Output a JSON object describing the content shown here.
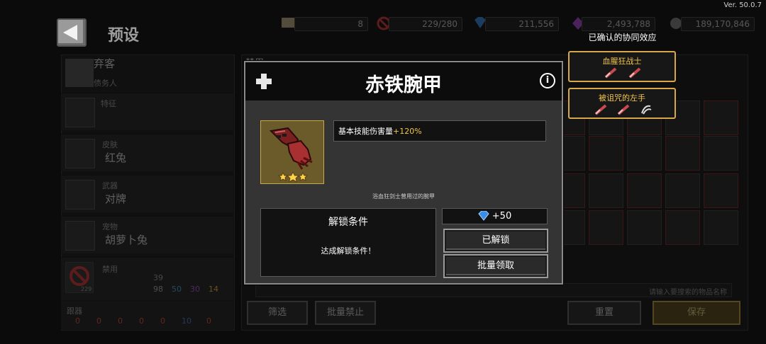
{
  "header": {
    "title": "预设",
    "version": "Ver. 50.0.7",
    "resources": [
      {
        "icon": "scroll-icon",
        "value": "8"
      },
      {
        "icon": "ban-icon",
        "value": "229/280"
      },
      {
        "icon": "diamond-icon",
        "value": "211,556"
      },
      {
        "icon": "purple-gem-icon",
        "value": "2,493,788"
      },
      {
        "icon": "coin-icon",
        "value": "189,170,846"
      }
    ]
  },
  "left_panel": {
    "character_name": "弃客",
    "character_sub": "债务人",
    "trait_label": "特征",
    "skin_label": "皮肤",
    "skin_value": "红兔",
    "weapon_label": "武器",
    "weapon_value": "对牌",
    "pet_label": "宠物",
    "pet_value": "胡萝卜兔",
    "ban_label": "禁用",
    "ban_count": "229",
    "ban_total": "39",
    "ban_breakdown": [
      "98",
      "50",
      "30",
      "14"
    ],
    "bottom_label": "跟器",
    "bottom_values": [
      "0",
      "0",
      "0",
      "0",
      "0",
      "10",
      "0"
    ]
  },
  "grid_panel": {
    "header_label": "禁用",
    "search_placeholder": "请输入要搜索的物品名称",
    "filter_button": "筛选",
    "batch_ban_button": "批量禁止",
    "reset_button": "重置",
    "save_button": "保存"
  },
  "modal": {
    "title": "赤铁腕甲",
    "stat_text": "基本技能伤害量",
    "stat_value": "+120%",
    "description": "浴血狂剑士曾用过的腕甲",
    "unlock_title": "解锁条件",
    "unlock_text": "达成解锁条件！",
    "cost": "+50",
    "unlocked_button": "已解锁",
    "batch_claim_button": "批量领取",
    "rarity_stars": 3
  },
  "synergy": {
    "title": "已确认的协同效应",
    "items": [
      {
        "name": "血腥狂战士",
        "icons": [
          "sword-icon",
          "sword-icon"
        ]
      },
      {
        "name": "被诅咒的左手",
        "icons": [
          "sword-icon",
          "sword-icon",
          "claw-icon"
        ]
      }
    ]
  },
  "colors": {
    "accent_gold": "#d6a84a",
    "stat_highlight": "#f3c64a",
    "diamond_blue": "#3a8ce8"
  }
}
